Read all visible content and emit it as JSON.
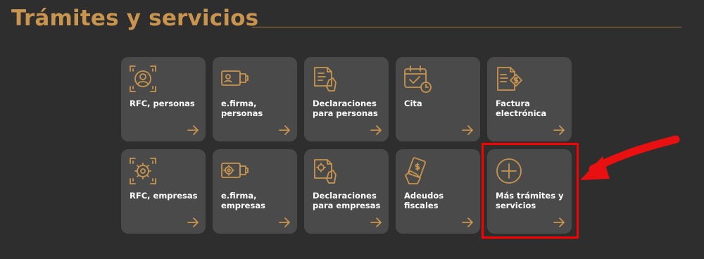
{
  "section": {
    "title": "Trámites y servicios"
  },
  "colors": {
    "accent": "#c9954e",
    "card": "#4a4a4a",
    "background": "#2e2e2e",
    "highlight": "#ff0000"
  },
  "cards": [
    {
      "label": "RFC, personas",
      "icon": "person-scan-icon"
    },
    {
      "label": "e.firma, personas",
      "icon": "id-card-usb-icon"
    },
    {
      "label": "Declaraciones para personas",
      "icon": "document-hand-icon"
    },
    {
      "label": "Cita",
      "icon": "calendar-clock-icon"
    },
    {
      "label": "Factura electrónica",
      "icon": "invoice-dollar-icon"
    },
    {
      "label": "RFC, empresas",
      "icon": "gear-scan-icon"
    },
    {
      "label": "e.firma, empresas",
      "icon": "gear-usb-icon"
    },
    {
      "label": "Declaraciones para empresas",
      "icon": "gear-document-hand-icon"
    },
    {
      "label": "Adeudos fiscales",
      "icon": "hand-dollar-icon"
    },
    {
      "label": "Más trámites y servicios",
      "icon": "plus-circle-icon"
    }
  ]
}
